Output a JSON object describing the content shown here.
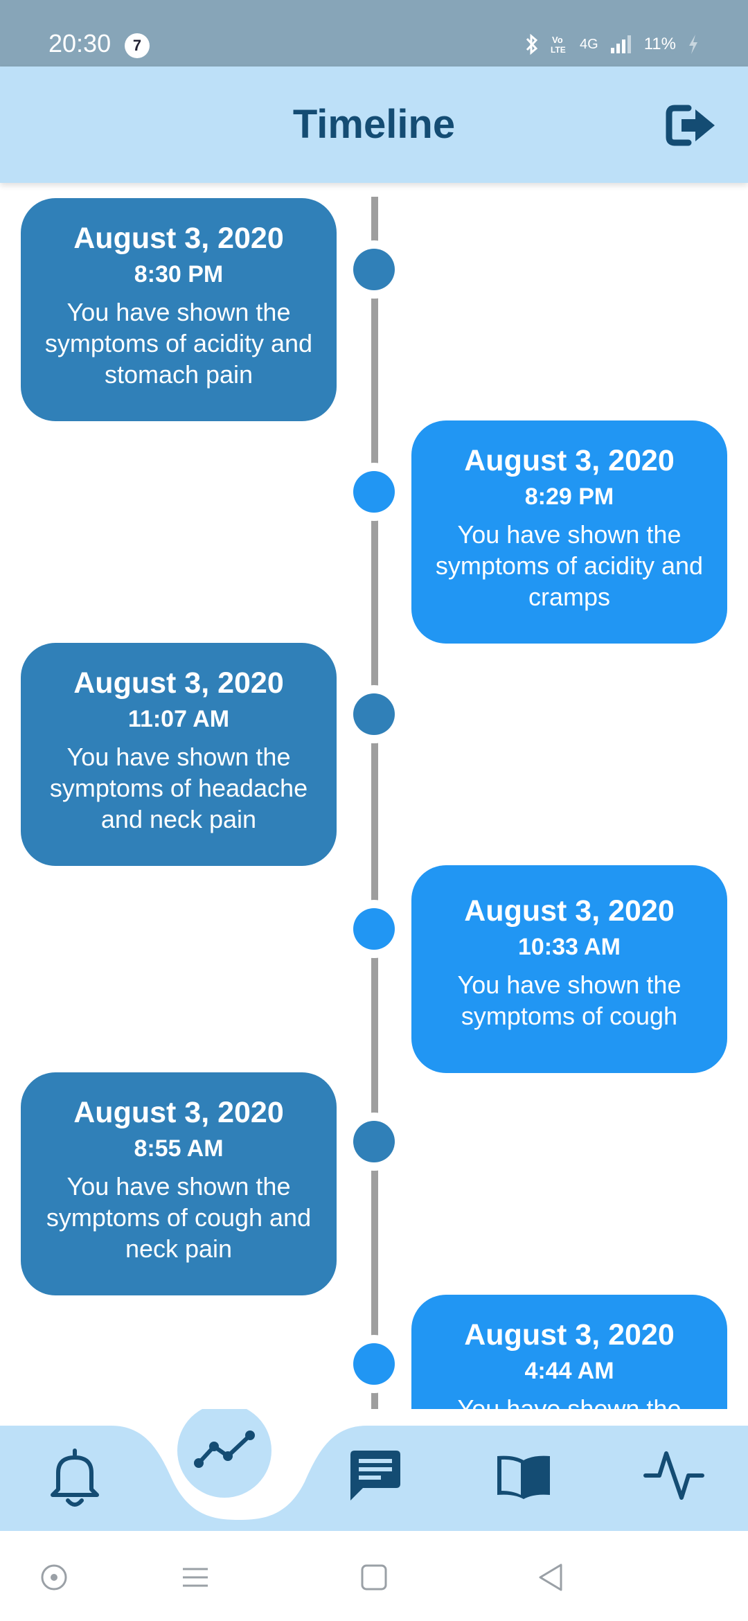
{
  "status_bar": {
    "time": "20:30",
    "notification_count": "7",
    "network": "4G",
    "battery": "11%"
  },
  "header": {
    "title": "Timeline"
  },
  "events": [
    {
      "date": "August 3, 2020",
      "time": "8:30 PM",
      "text": "You have shown the symptoms of acidity and stomach pain"
    },
    {
      "date": "August 3, 2020",
      "time": "8:29 PM",
      "text": "You have shown the symptoms of acidity and cramps"
    },
    {
      "date": "August 3, 2020",
      "time": "11:07 AM",
      "text": "You have shown the symptoms of headache and neck pain"
    },
    {
      "date": "August 3, 2020",
      "time": "10:33 AM",
      "text": "You have shown the symptoms of cough"
    },
    {
      "date": "August 3, 2020",
      "time": "8:55 AM",
      "text": "You have shown the symptoms of cough and neck pain"
    },
    {
      "date": "August 3, 2020",
      "time": "4:44 AM",
      "text": "You have shown the symptoms"
    }
  ],
  "bottom_nav": {
    "items": [
      "bell-icon",
      "trend-icon",
      "chat-icon",
      "book-icon",
      "activity-icon"
    ],
    "active": "trend-icon"
  },
  "colors": {
    "status_bar": "#87a5b8",
    "app_bar": "#bde0f8",
    "title": "#144c73",
    "card_dark": "#3080b8",
    "card_light": "#2196f3",
    "line": "#9e9e9e"
  }
}
